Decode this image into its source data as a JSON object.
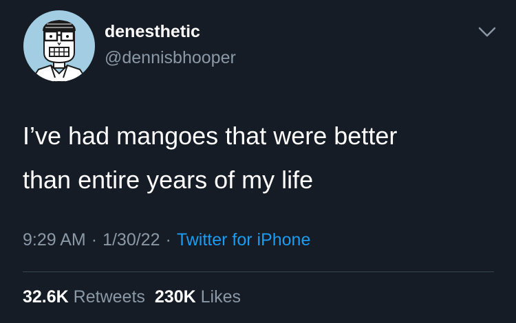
{
  "user": {
    "display_name": "denesthetic",
    "handle": "@dennisbhooper"
  },
  "tweet": {
    "lines": [
      "I’ve had mangoes that were better",
      "than entire years of my life"
    ],
    "time": "9:29 AM",
    "date": "1/30/22",
    "separator": "·",
    "source": "Twitter for iPhone"
  },
  "stats": {
    "retweets_count": "32.6K",
    "retweets_label": "Retweets",
    "likes_count": "230K",
    "likes_label": "Likes"
  },
  "icons": {
    "menu": "chevron-down-icon",
    "avatar": "cartoon-face-avatar"
  },
  "colors": {
    "background": "#161c26",
    "primary_text": "#ffffff",
    "secondary_text": "#8b98a5",
    "link": "#1d9bf0",
    "avatar_bg": "#a3cde3",
    "divider": "#38444d"
  }
}
